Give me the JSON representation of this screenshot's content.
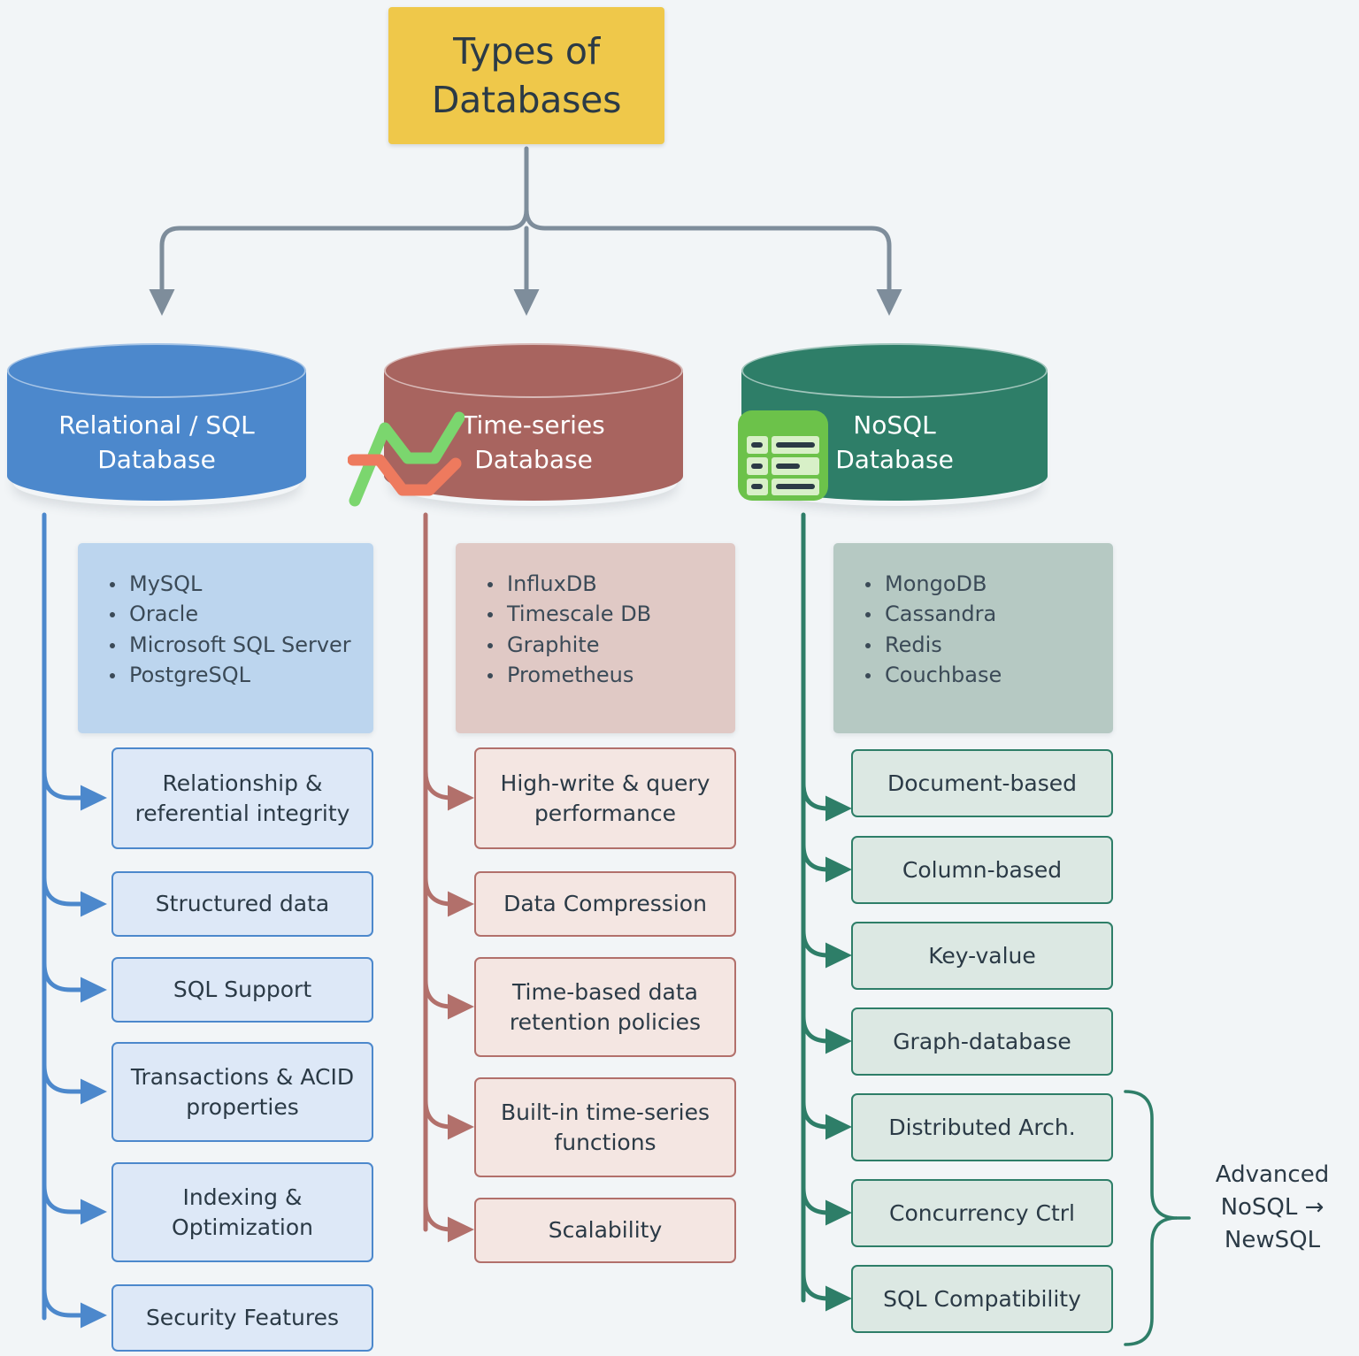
{
  "title": {
    "line1": "Types of",
    "line2": "Databases"
  },
  "colors": {
    "background": "#F2F5F7",
    "title_box": "#EFC84A",
    "sql_primary": "#4C88CC",
    "sql_panel": "#BCD5EE",
    "sql_card": "#DDE8F7",
    "timeseries_primary": "#A8645F",
    "timeseries_panel": "#E0C9C5",
    "timeseries_card": "#F4E6E2",
    "nosql_primary": "#2E7E68",
    "nosql_panel": "#B6C9C3",
    "nosql_card": "#DCE8E3",
    "connector_gray": "#7E8D9B",
    "icon_green": "#6CC24A",
    "icon_line_green": "#7BD66E",
    "icon_line_orange": "#EE7A5E",
    "text_dark": "#2B3A46"
  },
  "branches": [
    {
      "id": "relational",
      "cylinder_label_line1": "Relational / SQL",
      "cylinder_label_line2": "Database",
      "icon": null,
      "examples": [
        "MySQL",
        "Oracle",
        "Microsoft SQL Server",
        "PostgreSQL"
      ],
      "features": [
        "Relationship & referential integrity",
        "Structured data",
        "SQL Support",
        "Transactions & ACID properties",
        "Indexing & Optimization",
        "Security Features"
      ]
    },
    {
      "id": "timeseries",
      "cylinder_label_line1": "Time-series",
      "cylinder_label_line2": "Database",
      "icon": "line-chart-icon",
      "examples": [
        "InfluxDB",
        "Timescale DB",
        "Graphite",
        "Prometheus"
      ],
      "features": [
        "High-write & query performance",
        "Data Compression",
        "Time-based data retention policies",
        "Built-in time-series functions",
        "Scalability"
      ]
    },
    {
      "id": "nosql",
      "cylinder_label_line1": "NoSQL",
      "cylinder_label_line2": "Database",
      "icon": "database-rows-icon",
      "examples": [
        "MongoDB",
        "Cassandra",
        "Redis",
        "Couchbase"
      ],
      "features": [
        "Document-based",
        "Column-based",
        "Key-value",
        "Graph-database",
        "Distributed Arch.",
        "Concurrency Ctrl",
        "SQL Compatibility"
      ]
    }
  ],
  "bracket": {
    "label_line1": "Advanced",
    "label_line2": "NoSQL →",
    "label_line3": "NewSQL",
    "grouped_features": [
      "Distributed Arch.",
      "Concurrency Ctrl",
      "SQL Compatibility"
    ]
  }
}
